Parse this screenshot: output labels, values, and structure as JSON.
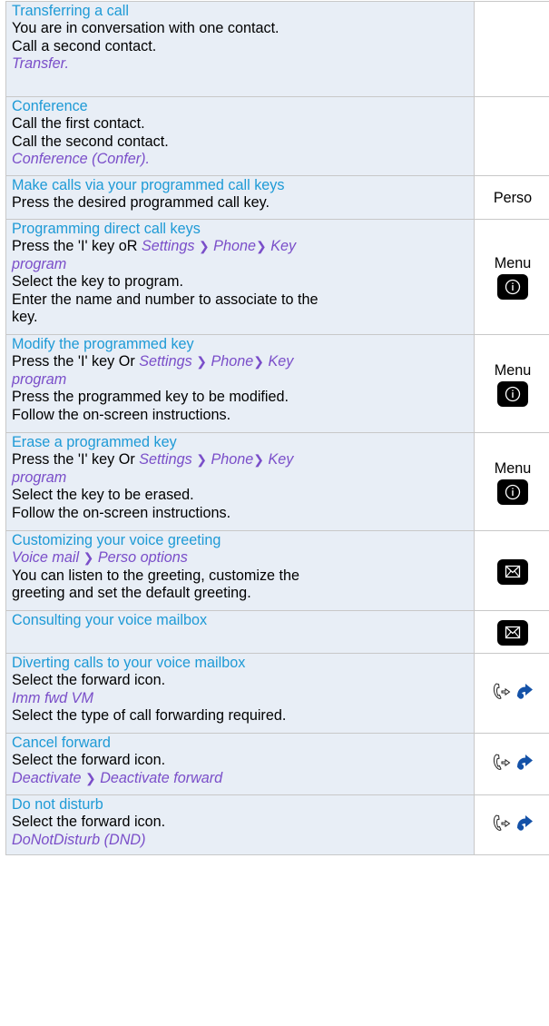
{
  "rows": [
    {
      "lines": [
        {
          "type": "title",
          "text": "Transferring a call"
        },
        {
          "type": "text",
          "text": "You are in conversation with one contact."
        },
        {
          "type": "text",
          "text": "Call a second contact."
        },
        {
          "type": "nav",
          "text": "Transfer."
        }
      ],
      "label": ""
    },
    {
      "lines": [
        {
          "type": "title",
          "text": "Conference"
        },
        {
          "type": "text",
          "text": "Call the first contact."
        },
        {
          "type": "text",
          "text": "Call the second contact."
        },
        {
          "type": "nav",
          "text": "Conference (Confer)."
        }
      ],
      "label": ""
    },
    {
      "lines": [
        {
          "type": "title",
          "text": "Make calls via your programmed call keys"
        },
        {
          "type": "text",
          "text": "Press the desired programmed call key."
        }
      ],
      "label": "Perso"
    },
    {
      "lines": [
        {
          "type": "title",
          "text": "Programming direct call keys"
        },
        {
          "type": "text",
          "text": "Press the 'I' key oR "
        },
        {
          "type": "nav",
          "text": "program"
        },
        {
          "type": "text",
          "text": "Select the key to program."
        },
        {
          "type": "text",
          "text": "Enter the name and number to associate to the"
        },
        {
          "type": "text",
          "text": "key."
        }
      ],
      "nav_parts": [
        "Settings",
        "Phone",
        "Key"
      ],
      "label": "Menu"
    },
    {
      "lines": [
        {
          "type": "title",
          "text": "Modify the programmed key"
        },
        {
          "type": "text",
          "text": "Press the 'I' key Or "
        },
        {
          "type": "nav",
          "text": "program"
        },
        {
          "type": "text",
          "text": "Press the programmed key to be modified."
        },
        {
          "type": "text",
          "text": "Follow the on-screen instructions."
        }
      ],
      "nav_parts": [
        "Settings",
        "Phone",
        "Key"
      ],
      "label": "Menu"
    },
    {
      "lines": [
        {
          "type": "title",
          "text": "Erase a programmed key"
        },
        {
          "type": "text",
          "text": "Press the 'I' key Or "
        },
        {
          "type": "nav",
          "text": "program"
        },
        {
          "type": "text",
          "text": "Select the key to be erased."
        },
        {
          "type": "text",
          "text": "Follow the on-screen instructions."
        }
      ],
      "nav_parts": [
        "Settings",
        "Phone",
        "Key"
      ],
      "label": "Menu"
    },
    {
      "lines": [
        {
          "type": "title",
          "text": "Customizing your voice greeting"
        },
        {
          "type": "text",
          "text": "You can listen to the greeting, customize the"
        },
        {
          "type": "text",
          "text": "greeting and set the default greeting."
        }
      ],
      "nav_parts": [
        "Voice mail",
        "Perso options"
      ],
      "label": ""
    },
    {
      "lines": [
        {
          "type": "title",
          "text": "Consulting your voice mailbox"
        }
      ],
      "label": ""
    },
    {
      "lines": [
        {
          "type": "title",
          "text": "Diverting calls to your voice mailbox"
        },
        {
          "type": "text",
          "text": "Select the forward icon."
        },
        {
          "type": "nav",
          "text": "Imm fwd VM"
        },
        {
          "type": "text",
          "text": "Select the type of call forwarding required."
        }
      ],
      "label": ""
    },
    {
      "lines": [
        {
          "type": "title",
          "text": "Cancel forward"
        },
        {
          "type": "text",
          "text": "Select the forward icon."
        }
      ],
      "nav_parts": [
        "Deactivate",
        "Deactivate forward"
      ],
      "label": ""
    },
    {
      "lines": [
        {
          "type": "title",
          "text": "Do not disturb"
        },
        {
          "type": "text",
          "text": "Select the forward icon."
        },
        {
          "type": "nav",
          "text": "DoNotDisturb (DND)"
        }
      ],
      "label": ""
    }
  ],
  "separator": "❯",
  "icons": {
    "menu_key": "info-key-icon",
    "mail_key": "mail-key-icon",
    "forward_handset": "forward-handset-icon",
    "forward_arrow": "forward-arrow-icon"
  },
  "colors": {
    "title": "#1e9ad6",
    "nav": "#7a4ec9",
    "row_shade": "#e8eef6",
    "border": "#c8c8c8",
    "forward_arrow": "#1452a8"
  }
}
